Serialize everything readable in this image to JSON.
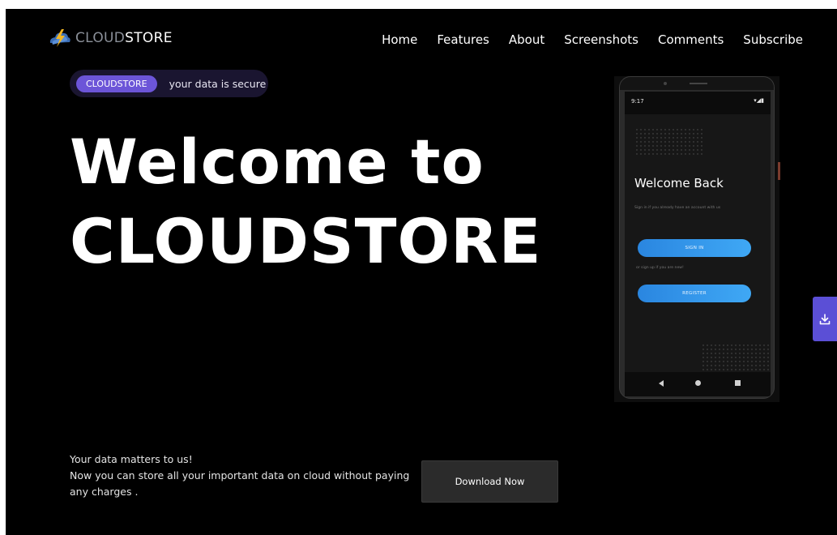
{
  "brand": {
    "name_part1": "CLOUD",
    "name_part2": "STORE",
    "logo_icon": "bolt-cloud-icon"
  },
  "nav": {
    "items": [
      "Home",
      "Features",
      "About",
      "Screenshots",
      "Comments",
      "Subscribe"
    ]
  },
  "badge": {
    "pill": "CLOUDSTORE",
    "text": "your data is secure"
  },
  "hero": {
    "line1": "Welcome to",
    "line2": "CLOUDSTORE"
  },
  "phone": {
    "time": "9:17",
    "status_icons": "▾◢▮",
    "title": "Welcome Back",
    "subtitle": "Sign in if you already have an account with us",
    "sign_in": "SIGN IN",
    "subtitle2": "or sign up if you are new!",
    "register": "REGISTER"
  },
  "fab": {
    "icon": "download-icon"
  },
  "copy": {
    "line1": "Your data matters to us!",
    "line2": "Now you can store all your important data on cloud without paying any charges ."
  },
  "download_button": "Download Now",
  "colors": {
    "accent": "#5b4fd6",
    "badge_pill": "#6c55d8",
    "app_button": "#3fa8f5",
    "background": "#000000"
  }
}
